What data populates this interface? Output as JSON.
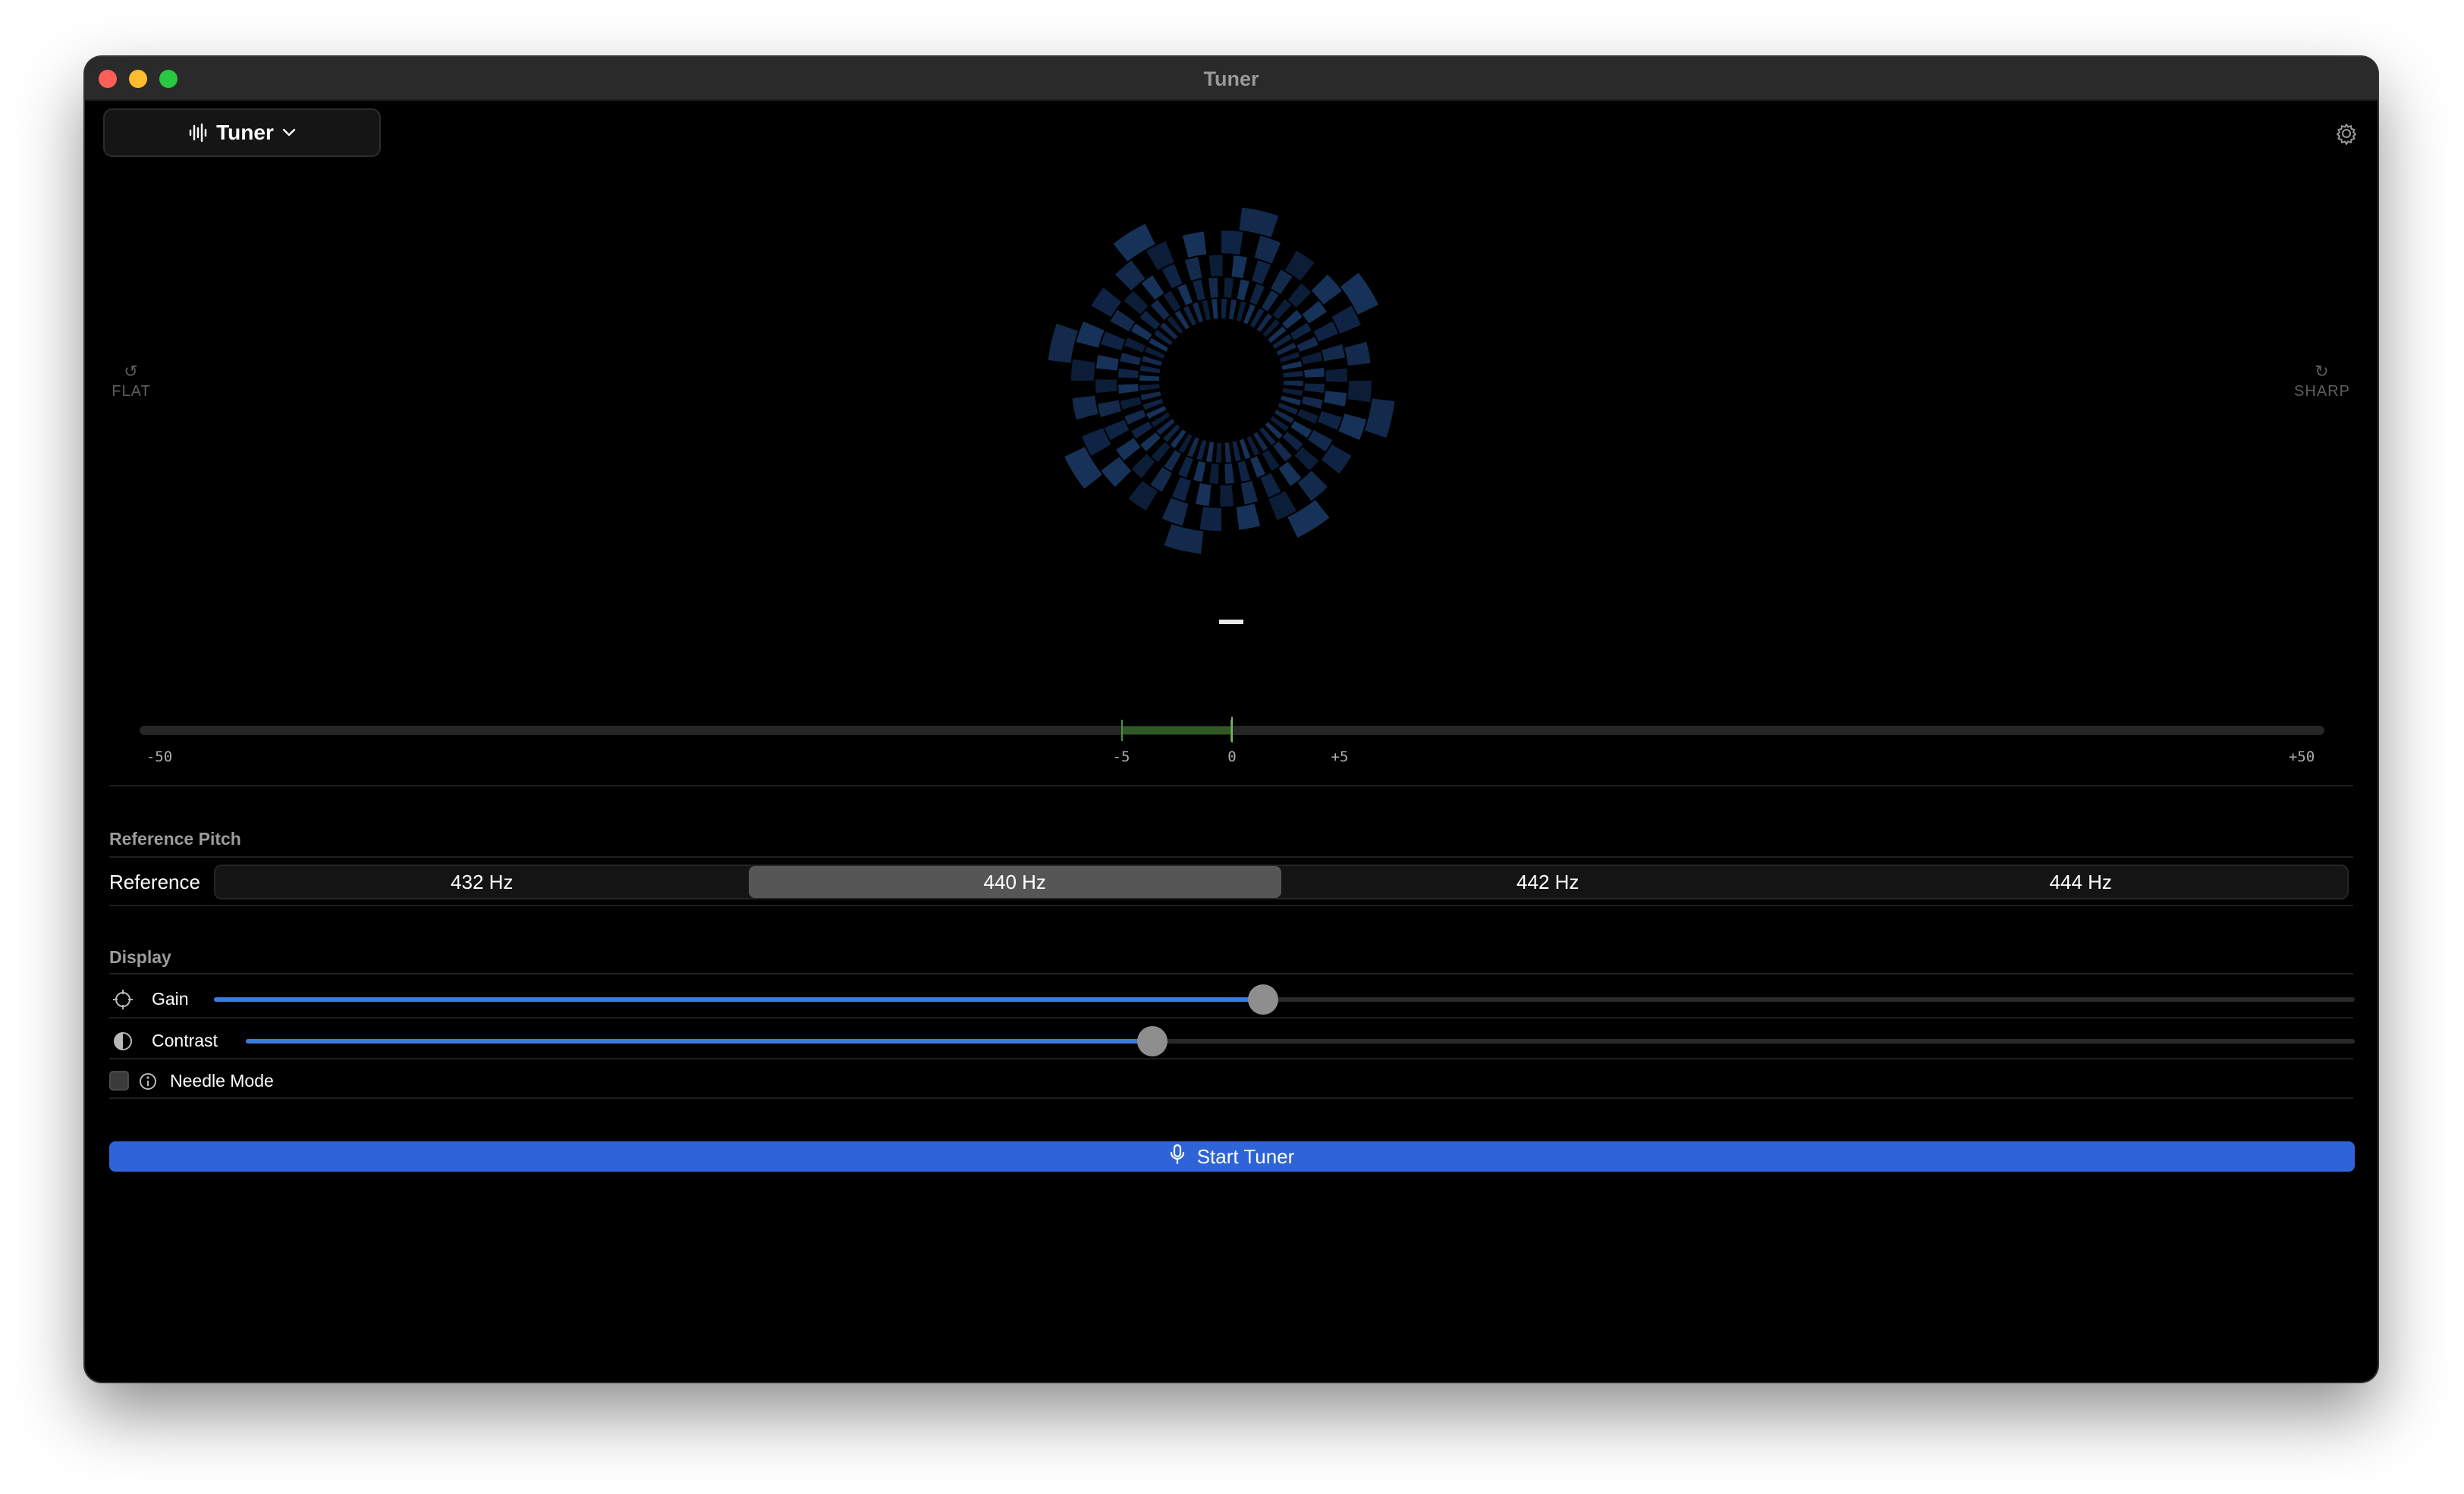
{
  "window": {
    "title": "Tuner"
  },
  "toolbar": {
    "mode_label": "Tuner",
    "mode_icon": "waveform-icon",
    "settings_icon": "gear-icon"
  },
  "strobe": {
    "flat_label": "FLAT",
    "sharp_label": "SHARP",
    "note": "–",
    "color": "#0f2444"
  },
  "meter": {
    "labels": [
      "-50",
      "-5",
      "0",
      "+5",
      "+50"
    ],
    "range": [
      -50,
      50
    ],
    "in_tune_zone": [
      -5,
      5
    ],
    "zone_color": "#4d8f3f"
  },
  "reference": {
    "section_title": "Reference Pitch",
    "row_label": "Reference",
    "options": [
      "432 Hz",
      "440 Hz",
      "442 Hz",
      "444 Hz"
    ],
    "selected": "440 Hz"
  },
  "display": {
    "section_title": "Display",
    "gain": {
      "label": "Gain",
      "value_fraction": 0.49
    },
    "contrast": {
      "label": "Contrast",
      "value_fraction": 0.43
    },
    "needle_mode": {
      "label": "Needle Mode",
      "checked": false
    }
  },
  "start_button": {
    "label": "Start Tuner",
    "icon": "microphone-icon",
    "color": "#2f63d8"
  }
}
